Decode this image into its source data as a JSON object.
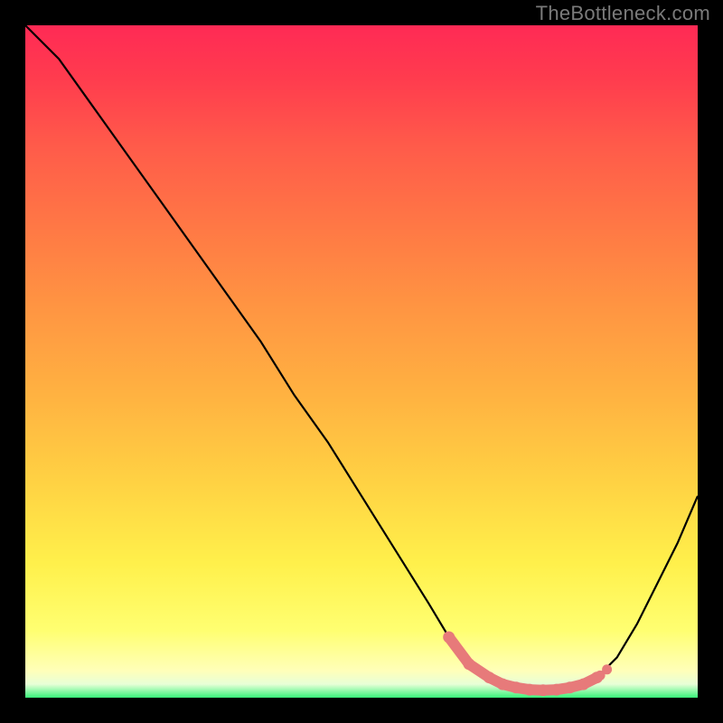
{
  "attribution": "TheBottleneck.com",
  "colors": {
    "frame": "#000000",
    "highlight_stroke": "#e77a7a",
    "curve_stroke": "#000000",
    "gradient_stops": [
      "#ff2a55",
      "#ff3c4e",
      "#ff5b4a",
      "#ff7845",
      "#ff9542",
      "#ffb241",
      "#ffd243",
      "#fff04b",
      "#ffff71",
      "#ffffb9",
      "#e7ffd7",
      "#38f57a"
    ]
  },
  "chart_data": {
    "type": "line",
    "title": "",
    "xlabel": "",
    "ylabel": "",
    "x": [
      0.0,
      0.05,
      0.1,
      0.15,
      0.2,
      0.25,
      0.3,
      0.35,
      0.4,
      0.45,
      0.5,
      0.55,
      0.6,
      0.63,
      0.66,
      0.69,
      0.71,
      0.73,
      0.75,
      0.77,
      0.79,
      0.81,
      0.83,
      0.85,
      0.88,
      0.91,
      0.94,
      0.97,
      1.0
    ],
    "values": [
      1.0,
      0.95,
      0.88,
      0.81,
      0.74,
      0.67,
      0.6,
      0.53,
      0.45,
      0.38,
      0.3,
      0.22,
      0.14,
      0.09,
      0.05,
      0.03,
      0.02,
      0.015,
      0.012,
      0.011,
      0.012,
      0.015,
      0.02,
      0.03,
      0.06,
      0.11,
      0.17,
      0.23,
      0.3
    ],
    "xlim": [
      0,
      1
    ],
    "ylim": [
      0,
      1
    ],
    "highlight_points_x": [
      0.63,
      0.66,
      0.69,
      0.71,
      0.73,
      0.75,
      0.77,
      0.79,
      0.81,
      0.83,
      0.85
    ],
    "highlight_points_y": [
      0.09,
      0.05,
      0.03,
      0.02,
      0.015,
      0.012,
      0.011,
      0.012,
      0.015,
      0.02,
      0.03
    ],
    "extra_dots_x": [
      0.855,
      0.865
    ],
    "extra_dots_y": [
      0.033,
      0.042
    ]
  }
}
